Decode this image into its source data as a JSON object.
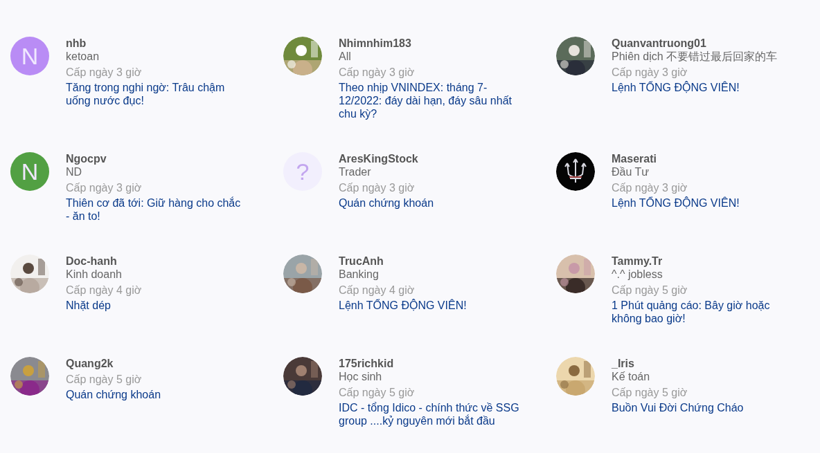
{
  "members": [
    {
      "name": "nhb",
      "role": "ketoan",
      "time": "Cấp ngày 3 giờ",
      "title": "Tăng trong nghi ngờ: Trâu chậm uống nước đục!",
      "avatar": {
        "kind": "letter",
        "letter": "N",
        "color": "#b98cf5"
      }
    },
    {
      "name": "Nhimnhim183",
      "role": "All",
      "time": "Cấp ngày 3 giờ",
      "title": "Theo nhịp VNINDEX: tháng 7-12/2022: đáy dài hạn, đáy sâu nhất chu kỳ?"
    },
    {
      "name": "Quanvantruong01",
      "role": "Phiên dịch 不要错过最后回家的车",
      "time": "Cấp ngày 3 giờ",
      "title": "Lệnh TỔNG ĐỘNG VIÊN!"
    },
    {
      "name": "Ngocpv",
      "role": "ND",
      "time": "Cấp ngày 3 giờ",
      "title": "Thiên cơ đã tới: Giữ hàng cho chắc - ăn to!",
      "avatar": {
        "kind": "letter",
        "letter": "N",
        "color": "#52a043"
      }
    },
    {
      "name": "AresKingStock",
      "role": "Trader",
      "time": "Cấp ngày 3 giờ",
      "title": "Quán chứng khoán",
      "avatar": {
        "kind": "unknown",
        "letter": "?"
      }
    },
    {
      "name": "Maserati",
      "role": "Đầu Tư",
      "time": "Cấp ngày 3 giờ",
      "title": "Lệnh TỔNG ĐỘNG VIÊN!",
      "avatar": {
        "kind": "emblem"
      }
    },
    {
      "name": "Doc-hanh",
      "role": "Kinh doanh",
      "time": "Cấp ngày 4 giờ",
      "title": "Nhặt dép"
    },
    {
      "name": "TrucAnh",
      "role": "Banking",
      "time": "Cấp ngày 4 giờ",
      "title": "Lệnh TỔNG ĐỘNG VIÊN!"
    },
    {
      "name": "Tammy.Tr",
      "role": "^.^ jobless",
      "time": "Cấp ngày 5 giờ",
      "title": "1 Phút quảng cáo: Bây giờ hoặc không bao giờ!"
    },
    {
      "name": "Quang2k",
      "time": "Cấp ngày 5 giờ",
      "title": "Quán chứng khoán"
    },
    {
      "name": "175richkid",
      "role": "Học sinh",
      "time": "Cấp ngày 5 giờ",
      "title": "IDC - tổng Idico - chính thức về SSG group ....kỷ nguyên mới bắt đầu"
    },
    {
      "name": "_Iris",
      "role": "Kế toán",
      "time": "Cấp ngày 5 giờ",
      "title": "Buồn Vui Đời Chứng Cháo"
    }
  ]
}
